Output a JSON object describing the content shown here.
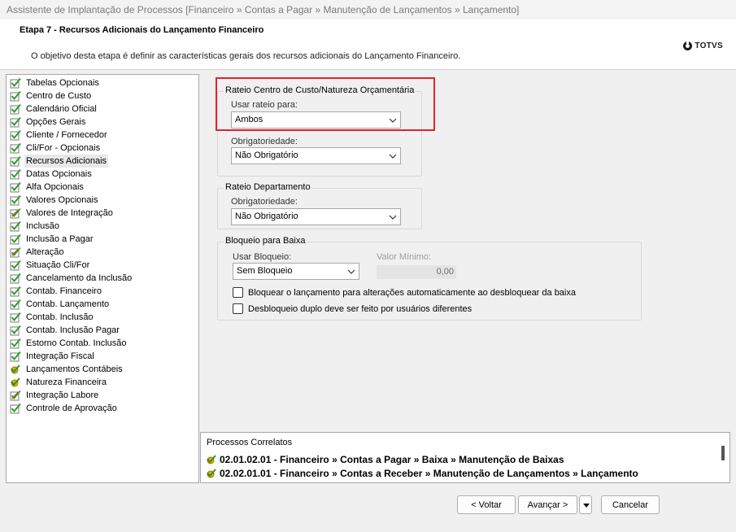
{
  "window": {
    "title": "Assistente de Implantação de Processos [Financeiro » Contas a Pagar » Manutenção de Lançamentos » Lançamento]"
  },
  "header": {
    "step_title": "Etapa 7 - Recursos Adicionais do Lançamento Financeiro",
    "description": "O objetivo desta etapa é definir as características gerais dos recursos adicionais do Lançamento Financeiro.",
    "logo_text": "TOTVS"
  },
  "nav": {
    "items": [
      {
        "label": "Tabelas Opcionais",
        "icon": "check-icon"
      },
      {
        "label": "Centro de Custo",
        "icon": "check-icon"
      },
      {
        "label": "Calendário Oficial",
        "icon": "check-icon"
      },
      {
        "label": "Opções Gerais",
        "icon": "check-icon"
      },
      {
        "label": "Cliente / Fornecedor",
        "icon": "check-icon"
      },
      {
        "label": "Cli/For - Opcionais",
        "icon": "check-icon"
      },
      {
        "label": "Recursos Adicionais",
        "icon": "check-icon"
      },
      {
        "label": "Datas Opcionais",
        "icon": "check-icon"
      },
      {
        "label": "Alfa Opcionais",
        "icon": "check-icon"
      },
      {
        "label": "Valores Opcionais",
        "icon": "check-icon"
      },
      {
        "label": "Valores de Integração",
        "icon": "edit-icon"
      },
      {
        "label": "Inclusão",
        "icon": "check-icon"
      },
      {
        "label": "Inclusão a Pagar",
        "icon": "check-icon"
      },
      {
        "label": "Alteração",
        "icon": "edit-icon"
      },
      {
        "label": "Situação Cli/For",
        "icon": "check-icon"
      },
      {
        "label": "Cancelamento da Inclusão",
        "icon": "check-icon"
      },
      {
        "label": "Contab. Financeiro",
        "icon": "check-icon"
      },
      {
        "label": "Contab. Lançamento",
        "icon": "check-icon"
      },
      {
        "label": "Contab. Inclusão",
        "icon": "check-icon"
      },
      {
        "label": "Contab. Inclusão Pagar",
        "icon": "check-icon"
      },
      {
        "label": "Estorno Contab. Inclusão",
        "icon": "check-icon"
      },
      {
        "label": "Integração Fiscal",
        "icon": "check-icon"
      },
      {
        "label": "Lançamentos Contábeis",
        "icon": "gear-check-icon"
      },
      {
        "label": "Natureza Financeira",
        "icon": "gear-check-icon"
      },
      {
        "label": "Integração Labore",
        "icon": "edit-icon"
      },
      {
        "label": "Controle de Aprovação",
        "icon": "check-icon"
      }
    ]
  },
  "rateio_cc": {
    "group_label": "Rateio Centro de Custo/Natureza Orçamentária",
    "usar_label": "Usar rateio para:",
    "usar_value": "Ambos",
    "obrig_label": "Obrigatoriedade:",
    "obrig_value": "Não Obrigatório"
  },
  "rateio_dep": {
    "group_label": "Rateio Departamento",
    "obrig_label": "Obrigatoriedade:",
    "obrig_value": "Não Obrigatório"
  },
  "bloqueio": {
    "group_label": "Bloqueio para Baixa",
    "usar_label": "Usar Bloqueio:",
    "usar_value": "Sem Bloqueio",
    "valor_label": "Valor Mínimo:",
    "valor_value": "0,00",
    "check1": "Bloquear o lançamento para alterações automaticamente ao desbloquear da baixa",
    "check2": "Desbloqueio duplo deve ser feito por usuários diferentes"
  },
  "related": {
    "title": "Processos Correlatos",
    "items": [
      "02.01.02.01 - Financeiro » Contas a Pagar » Baixa » Manutenção de Baixas",
      "02.02.01.01 - Financeiro » Contas a Receber » Manutenção de Lançamentos » Lançamento"
    ]
  },
  "footer": {
    "back_label": "< Voltar",
    "next_label": "Avançar >",
    "cancel_label": "Cancelar"
  },
  "colors": {
    "highlight": "#e0242d",
    "check_green": "#3a9c3a"
  }
}
